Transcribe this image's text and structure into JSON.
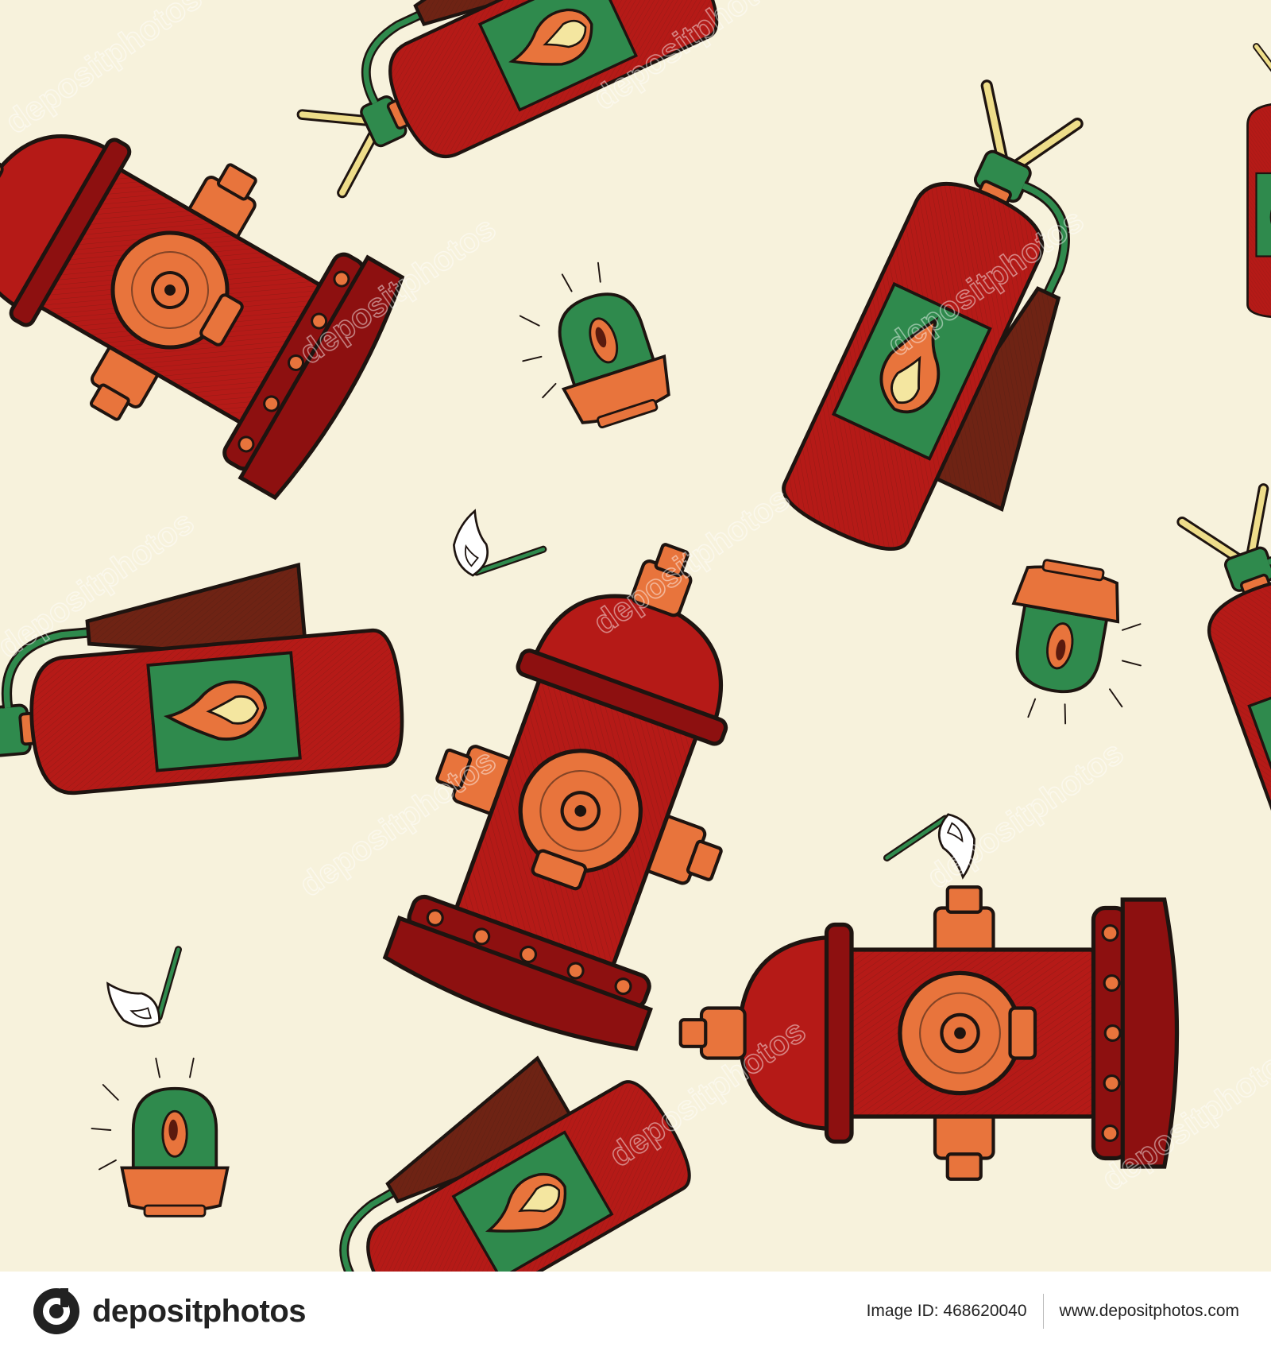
{
  "colors": {
    "background": "#f7f2dc",
    "hydrant_red": "#b51a17",
    "hydrant_dark": "#8d1010",
    "orange": "#e8743c",
    "green": "#2f8a4d",
    "brown": "#6e2314",
    "flame_cream": "#f4e6a0",
    "yellow": "#eedd8a",
    "outline": "#1e1410",
    "footer_bg": "#ffffff",
    "footer_text": "#222222"
  },
  "watermark": {
    "text": "depositphotos"
  },
  "footer": {
    "logo_text": "depositphotos",
    "image_id_label": "Image ID: 468620040",
    "website": "www.depositphotos.com"
  },
  "icons": {
    "logo": "depositphotos-logo-icon",
    "hydrant": "fire-hydrant-icon",
    "extinguisher": "fire-extinguisher-icon",
    "siren": "siren-light-icon",
    "match": "burning-match-icon"
  }
}
